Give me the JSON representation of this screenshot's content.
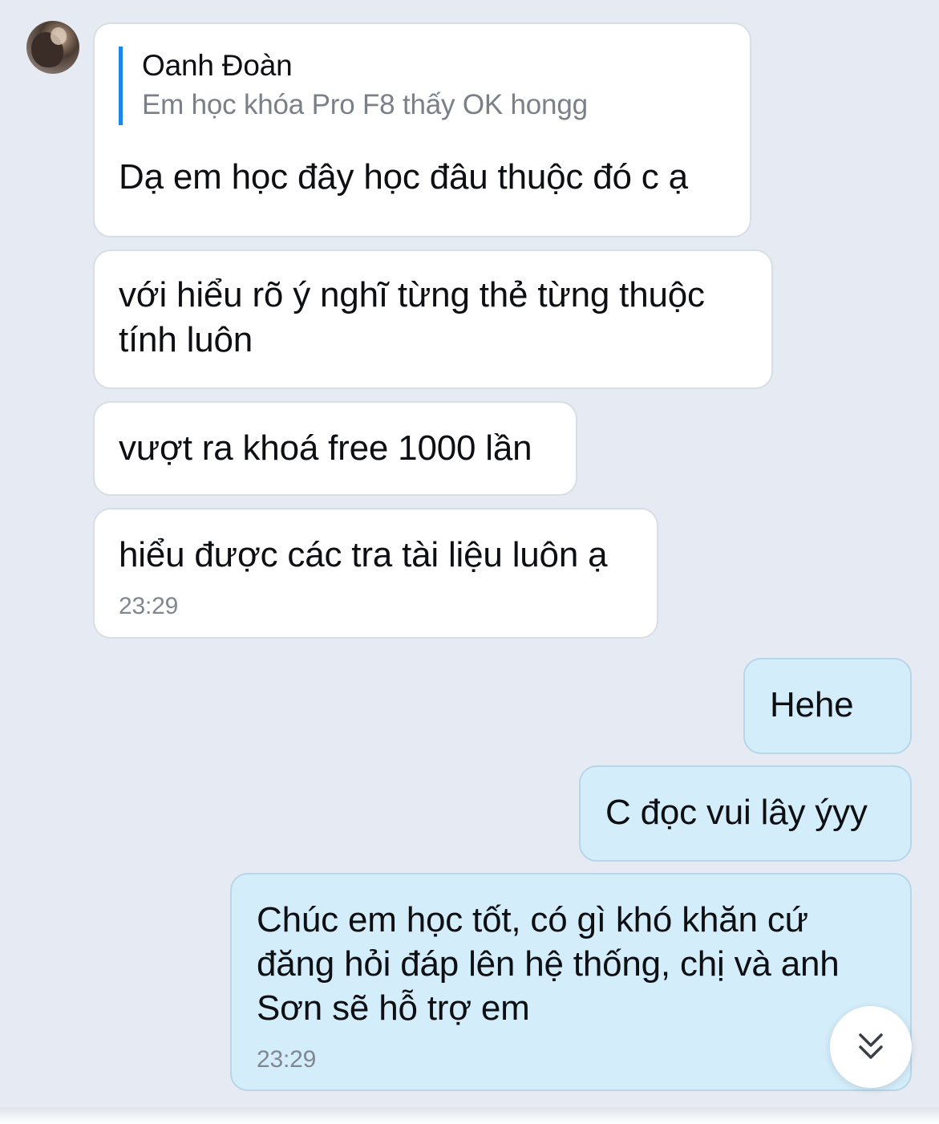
{
  "colors": {
    "background": "#e6eaf2",
    "incoming_bubble": "#ffffff",
    "outgoing_bubble": "#d4edfb",
    "quote_accent": "#1e86e8",
    "muted_text": "#808790"
  },
  "incoming": {
    "avatar_icon": "user-avatar-photo",
    "quote": {
      "name": "Oanh Đoàn",
      "text": "Em học khóa Pro F8 thấy OK hongg"
    },
    "messages": [
      {
        "lines": [
          "Dạ em học đây học đâu thuộc đó c ạ"
        ]
      },
      {
        "lines": [
          "với hiểu rõ ý nghĩ từng thẻ từng thuộc",
          "tính luôn"
        ]
      },
      {
        "lines": [
          "vượt ra khoá free 1000 lần"
        ]
      },
      {
        "lines": [
          "hiểu được các tra tài liệu luôn ạ"
        ],
        "time": "23:29"
      }
    ]
  },
  "outgoing": {
    "messages": [
      {
        "lines": [
          "Hehe"
        ]
      },
      {
        "lines": [
          "C đọc vui lây ýyy"
        ]
      },
      {
        "lines": [
          "Chúc em học tốt, có gì khó khăn cứ",
          "đăng hỏi đáp lên hệ thống, chị và anh",
          "Sơn sẽ hỗ trợ em"
        ],
        "time": "23:29"
      }
    ]
  },
  "scroll_button_icon": "chevrons-down-icon"
}
